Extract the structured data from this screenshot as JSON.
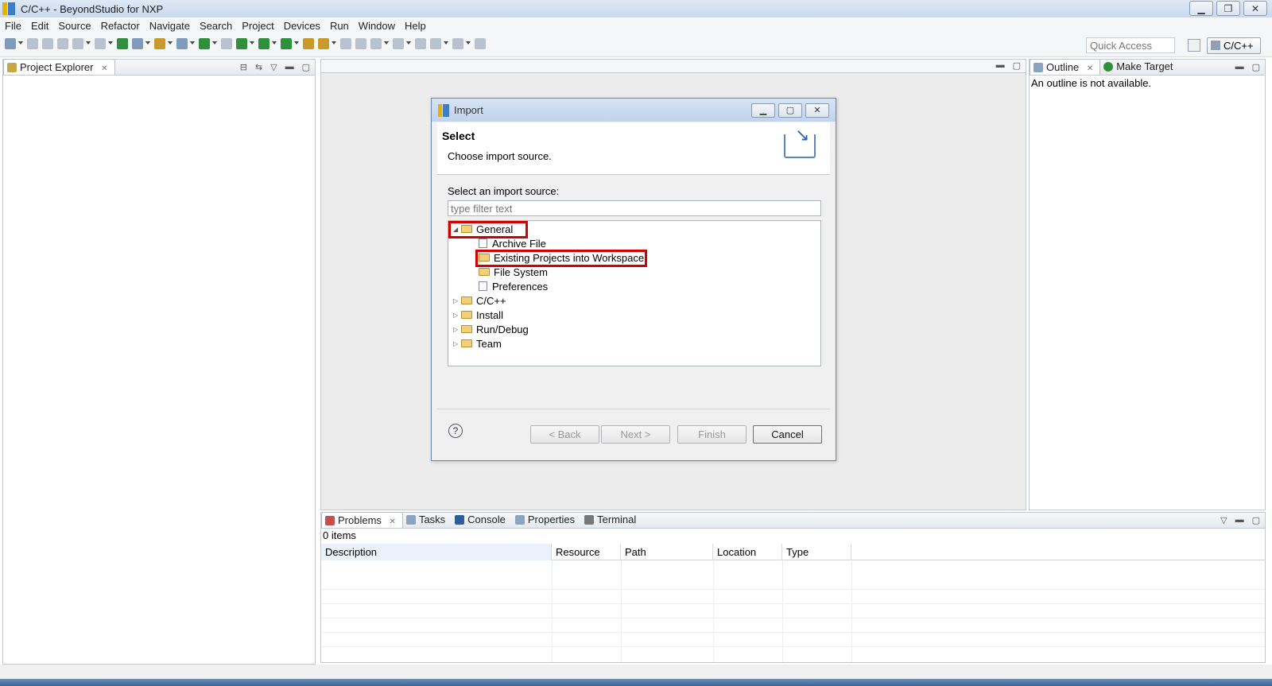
{
  "window": {
    "title": "C/C++ - BeyondStudio for NXP"
  },
  "menu": [
    "File",
    "Edit",
    "Source",
    "Refactor",
    "Navigate",
    "Search",
    "Project",
    "Devices",
    "Run",
    "Window",
    "Help"
  ],
  "toolbar": {
    "quick_access_placeholder": "Quick Access",
    "perspective": "C/C++"
  },
  "project_explorer": {
    "tab": "Project Explorer"
  },
  "outline": {
    "tab_outline": "Outline",
    "tab_make_target": "Make Target",
    "message": "An outline is not available."
  },
  "dialog": {
    "title": "Import",
    "header_title": "Select",
    "header_desc": "Choose import source.",
    "source_label": "Select an import source:",
    "filter_placeholder": "type filter text",
    "tree": [
      {
        "label": "General",
        "expanded": true
      },
      {
        "label": "Archive File"
      },
      {
        "label": "Existing Projects into Workspace"
      },
      {
        "label": "File System"
      },
      {
        "label": "Preferences"
      },
      {
        "label": "C/C++"
      },
      {
        "label": "Install"
      },
      {
        "label": "Run/Debug"
      },
      {
        "label": "Team"
      }
    ],
    "buttons": {
      "back": "< Back",
      "next": "Next >",
      "finish": "Finish",
      "cancel": "Cancel",
      "help": "?"
    }
  },
  "bottom_panel": {
    "tabs": [
      "Problems",
      "Tasks",
      "Console",
      "Properties",
      "Terminal"
    ],
    "items_count": "0 items",
    "columns": [
      "Description",
      "Resource",
      "Path",
      "Location",
      "Type"
    ]
  },
  "colors": {
    "highlight_box": "#d40000"
  }
}
